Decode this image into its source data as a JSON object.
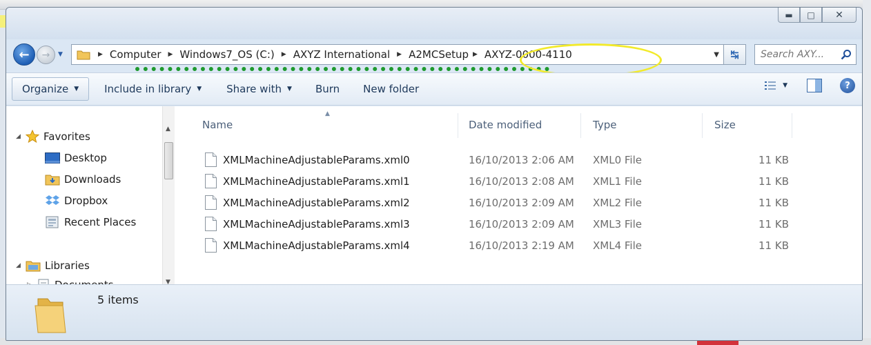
{
  "window": {
    "caption": {
      "minimize_icon": "minimize-icon",
      "maximize_icon": "maximize-icon",
      "close_icon": "close-icon"
    }
  },
  "address": {
    "crumbs": [
      "Computer",
      "Windows7_OS (C:)",
      "AXYZ International",
      "A2MCSetup",
      "AXYZ-0000-4110"
    ],
    "search_placeholder": "Search AXY..."
  },
  "toolbar": {
    "organize": "Organize",
    "include_in_library": "Include in library",
    "share_with": "Share with",
    "burn": "Burn",
    "new_folder": "New folder"
  },
  "navpane": {
    "favorites": "Favorites",
    "items": [
      "Desktop",
      "Downloads",
      "Dropbox",
      "Recent Places"
    ],
    "libraries": "Libraries",
    "library_items": [
      "Documents"
    ]
  },
  "columns": {
    "name": "Name",
    "date": "Date modified",
    "type": "Type",
    "size": "Size"
  },
  "files": [
    {
      "name": "XMLMachineAdjustableParams.xml0",
      "date": "16/10/2013 2:06 AM",
      "type": "XML0 File",
      "size": "11 KB"
    },
    {
      "name": "XMLMachineAdjustableParams.xml1",
      "date": "16/10/2013 2:08 AM",
      "type": "XML1 File",
      "size": "11 KB"
    },
    {
      "name": "XMLMachineAdjustableParams.xml2",
      "date": "16/10/2013 2:09 AM",
      "type": "XML2 File",
      "size": "11 KB"
    },
    {
      "name": "XMLMachineAdjustableParams.xml3",
      "date": "16/10/2013 2:09 AM",
      "type": "XML3 File",
      "size": "11 KB"
    },
    {
      "name": "XMLMachineAdjustableParams.xml4",
      "date": "16/10/2013 2:19 AM",
      "type": "XML4 File",
      "size": "11 KB"
    }
  ],
  "status": {
    "count": "5 items"
  },
  "colors": {
    "annotation_dash": "#1f9a2e",
    "annotation_ellipse": "#f2ea2a"
  }
}
